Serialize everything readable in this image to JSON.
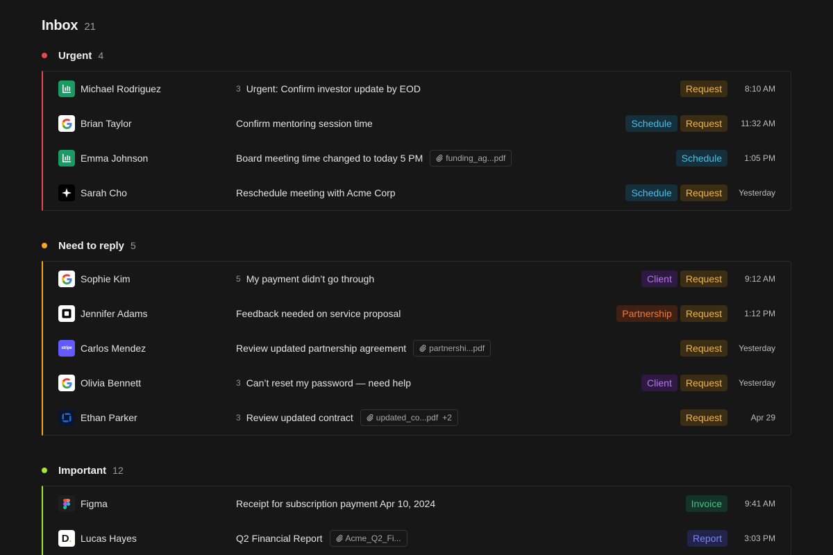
{
  "inbox": {
    "title": "Inbox",
    "count": "21"
  },
  "colors": {
    "urgent": "#e5484d",
    "need_to_reply": "#f5a623",
    "important": "#a3e635"
  },
  "sections": [
    {
      "title": "Urgent",
      "count": "4",
      "rows": [
        {
          "sender": "Michael Rodriguez",
          "logo": "bar-chart-logo",
          "thread_count": "3",
          "subject": "Urgent: Confirm investor update by EOD",
          "attachment": "",
          "attachment_extra": "",
          "tags": [
            "Request"
          ],
          "time": "8:10 AM"
        },
        {
          "sender": "Brian Taylor",
          "logo": "google-logo",
          "thread_count": "",
          "subject": "Confirm mentoring session time",
          "attachment": "",
          "attachment_extra": "",
          "tags": [
            "Schedule",
            "Request"
          ],
          "time": "11:32 AM"
        },
        {
          "sender": "Emma Johnson",
          "logo": "bar-chart-logo",
          "thread_count": "",
          "subject": "Board meeting time changed to today 5 PM",
          "attachment": "funding_ag...pdf",
          "attachment_extra": "",
          "tags": [
            "Schedule"
          ],
          "time": "1:05 PM"
        },
        {
          "sender": "Sarah Cho",
          "logo": "sparkle-logo",
          "thread_count": "",
          "subject": "Reschedule meeting with Acme Corp",
          "attachment": "",
          "attachment_extra": "",
          "tags": [
            "Schedule",
            "Request"
          ],
          "time": "Yesterday"
        }
      ]
    },
    {
      "title": "Need to reply",
      "count": "5",
      "rows": [
        {
          "sender": "Sophie Kim",
          "logo": "google-logo",
          "thread_count": "5",
          "subject": "My payment didn’t go through",
          "attachment": "",
          "attachment_extra": "",
          "tags": [
            "Client",
            "Request"
          ],
          "time": "9:12 AM"
        },
        {
          "sender": "Jennifer Adams",
          "logo": "square-logo",
          "thread_count": "",
          "subject": "Feedback needed on service proposal",
          "attachment": "",
          "attachment_extra": "",
          "tags": [
            "Partnership",
            "Request"
          ],
          "time": "1:12 PM"
        },
        {
          "sender": "Carlos Mendez",
          "logo": "stripe-logo",
          "thread_count": "",
          "subject": "Review updated partnership agreement",
          "attachment": "partnershi...pdf",
          "attachment_extra": "",
          "tags": [
            "Request"
          ],
          "time": "Yesterday"
        },
        {
          "sender": "Olivia Bennett",
          "logo": "google-logo",
          "thread_count": "3",
          "subject": "Can’t reset my password — need help",
          "attachment": "",
          "attachment_extra": "",
          "tags": [
            "Client",
            "Request"
          ],
          "time": "Yesterday"
        },
        {
          "sender": "Ethan Parker",
          "logo": "chase-logo",
          "thread_count": "3",
          "subject": "Review updated contract",
          "attachment": "updated_co...pdf",
          "attachment_extra": "+2",
          "tags": [
            "Request"
          ],
          "time": "Apr 29"
        }
      ]
    },
    {
      "title": "Important",
      "count": "12",
      "rows": [
        {
          "sender": "Figma",
          "logo": "figma-logo",
          "thread_count": "",
          "subject": "Receipt for subscription payment Apr 10, 2024",
          "attachment": "",
          "attachment_extra": "",
          "tags": [
            "Invoice"
          ],
          "time": "9:41 AM"
        },
        {
          "sender": "Lucas Hayes",
          "logo": "d-logo",
          "thread_count": "",
          "subject": "Q2 Financial Report",
          "attachment": "Acme_Q2_Fi...",
          "attachment_extra": "",
          "tags": [
            "Report"
          ],
          "time": "3:03 PM"
        }
      ]
    }
  ]
}
